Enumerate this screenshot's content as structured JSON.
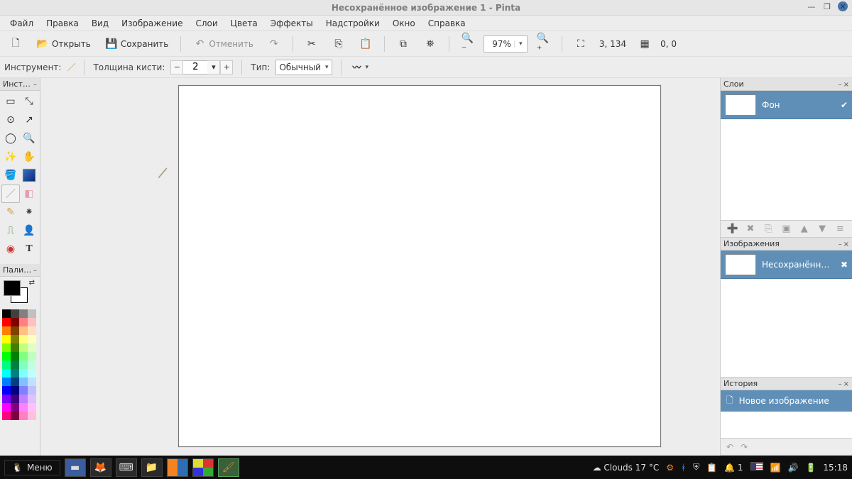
{
  "window": {
    "title": "Несохранённое изображение 1 - Pinta"
  },
  "menus": [
    "Файл",
    "Правка",
    "Вид",
    "Изображение",
    "Слои",
    "Цвета",
    "Эффекты",
    "Надстройки",
    "Окно",
    "Справка"
  ],
  "toolbar": {
    "open": "Открыть",
    "save": "Сохранить",
    "undo": "Отменить",
    "zoom_value": "97%",
    "coords": "3, 134",
    "sel_coords": "0, 0"
  },
  "tool_options": {
    "tool_label": "Инструмент:",
    "brush_width_label": "Толщина кисти:",
    "brush_width_value": "2",
    "type_label": "Тип:",
    "type_value": "Обычный"
  },
  "panels": {
    "tools_title": "Инст…",
    "palette_title": "Пали…",
    "layers_title": "Слои",
    "images_title": "Изображения",
    "history_title": "История"
  },
  "layers": [
    {
      "name": "Фон",
      "visible": true
    }
  ],
  "images": [
    {
      "name": "Несохранённ…"
    }
  ],
  "history": [
    {
      "name": "Новое изображение"
    }
  ],
  "palette_colors_row1": [
    "#ffffff",
    "#c0c0c0",
    "#808080",
    "#404040"
  ],
  "palette_colors": [
    "#000000",
    "#404040",
    "#808080",
    "#c0c0c0",
    "#ff0000",
    "#800000",
    "#ff8080",
    "#ffc0c0",
    "#ff8000",
    "#804000",
    "#ffc080",
    "#ffe0c0",
    "#ffff00",
    "#808000",
    "#ffff80",
    "#ffffc0",
    "#80ff00",
    "#408000",
    "#c0ff80",
    "#e0ffc0",
    "#00ff00",
    "#008000",
    "#80ff80",
    "#c0ffc0",
    "#00ff80",
    "#008040",
    "#80ffc0",
    "#c0ffe0",
    "#00ffff",
    "#008080",
    "#80ffff",
    "#c0ffff",
    "#0080ff",
    "#004080",
    "#80c0ff",
    "#c0e0ff",
    "#0000ff",
    "#000080",
    "#8080ff",
    "#c0c0ff",
    "#8000ff",
    "#400080",
    "#c080ff",
    "#e0c0ff",
    "#ff00ff",
    "#800080",
    "#ff80ff",
    "#ffc0ff",
    "#ff0080",
    "#800040",
    "#ff80c0",
    "#ffc0e0"
  ],
  "taskbar": {
    "menu": "Меню",
    "weather": "Clouds 17 °C",
    "notifications": "1",
    "time": "15:18"
  }
}
